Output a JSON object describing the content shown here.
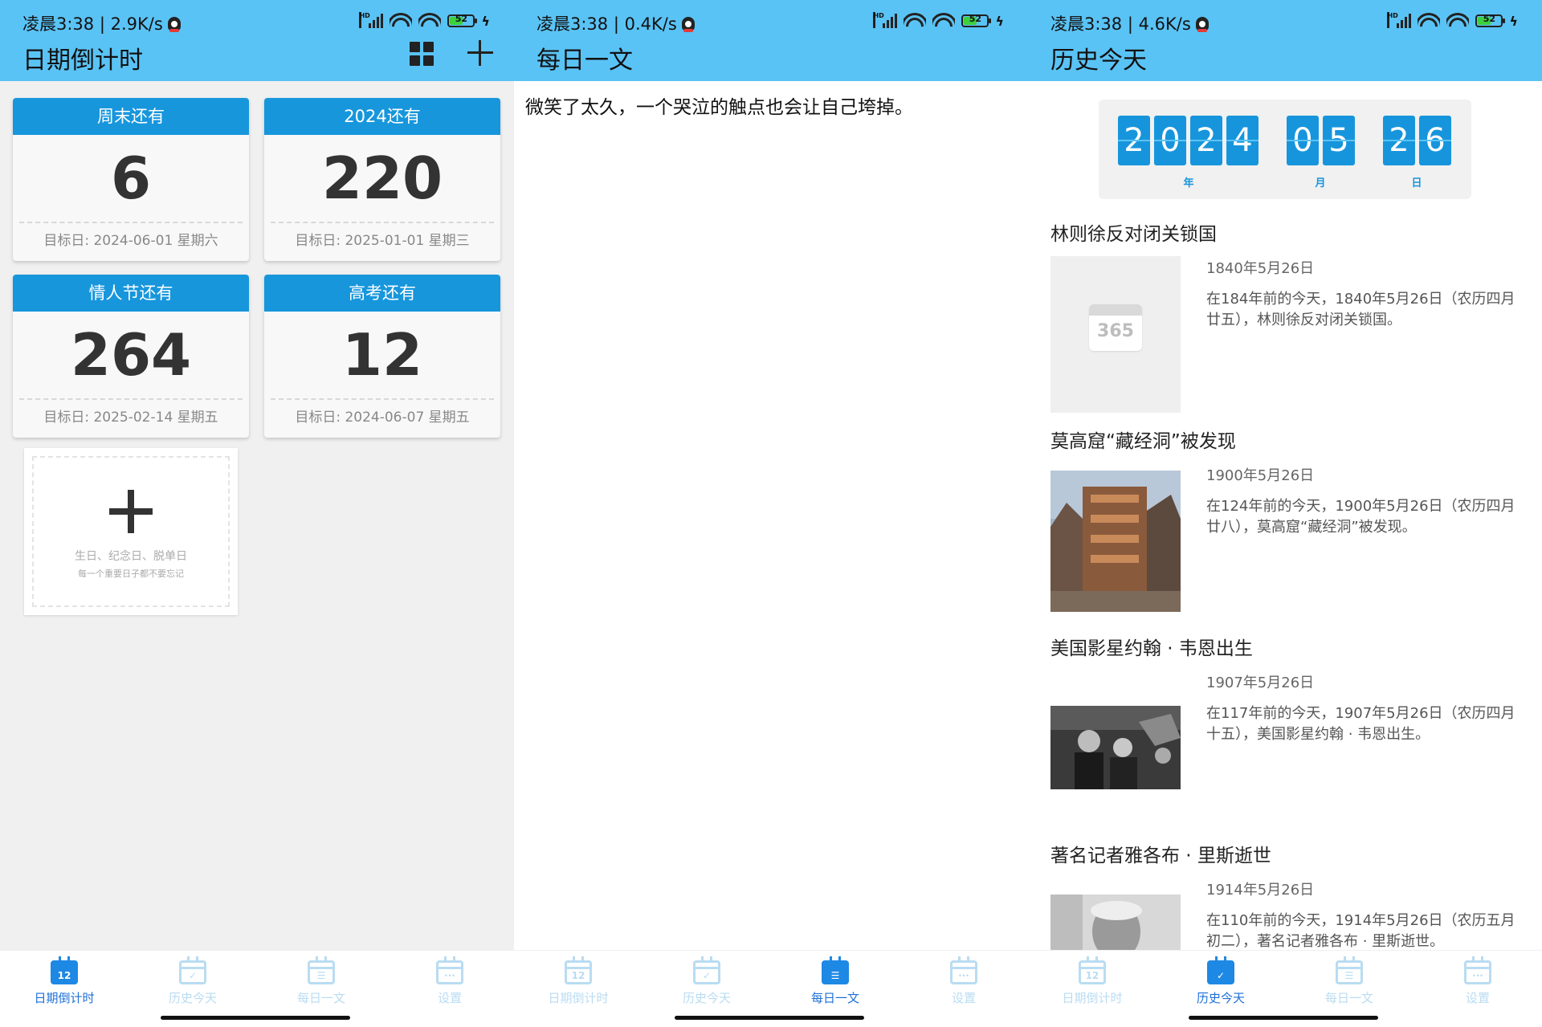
{
  "screens": [
    {
      "status": "凌晨3:38 | 2.9K/s",
      "title": "日期倒计时",
      "cards": [
        {
          "label": "周末还有",
          "days": "6",
          "target": "目标日: 2024-06-01 星期六"
        },
        {
          "label": "2024还有",
          "days": "220",
          "target": "目标日: 2025-01-01 星期三"
        },
        {
          "label": "情人节还有",
          "days": "264",
          "target": "目标日: 2025-02-14 星期五"
        },
        {
          "label": "高考还有",
          "days": "12",
          "target": "目标日: 2024-06-07 星期五"
        }
      ],
      "add_card": {
        "line1": "生日、纪念日、脱单日",
        "line2": "每一个重要日子都不要忘记"
      }
    },
    {
      "status": "凌晨3:38 | 0.4K/s",
      "title": "每日一文",
      "text": "微笑了太久，一个哭泣的触点也会让自己垮掉。"
    },
    {
      "status": "凌晨3:38 | 4.6K/s",
      "title": "历史今天",
      "date_digits": [
        "2",
        "0",
        "2",
        "4",
        "0",
        "5",
        "2",
        "6"
      ],
      "date_labels": {
        "year": "年",
        "month": "月",
        "day": "日"
      },
      "placeholder_text": "365",
      "events": [
        {
          "title": "林则徐反对闭关锁国",
          "date": "1840年5月26日",
          "desc": "在184年前的今天，1840年5月26日（农历四月廿五），林则徐反对闭关锁国。"
        },
        {
          "title": "莫高窟“藏经洞”被发现",
          "date": "1900年5月26日",
          "desc": "在124年前的今天，1900年5月26日（农历四月廿八），莫高窟“藏经洞”被发现。"
        },
        {
          "title": "美国影星约翰 · 韦恩出生",
          "date": "1907年5月26日",
          "desc": "在117年前的今天，1907年5月26日（农历四月十五），美国影星约翰 · 韦恩出生。"
        },
        {
          "title": "著名记者雅各布 · 里斯逝世",
          "date": "1914年5月26日",
          "desc": "在110年前的今天，1914年5月26日（农历五月初二），著名记者雅各布 · 里斯逝世。"
        }
      ]
    }
  ],
  "battery": "52",
  "nav": {
    "countdown": "日期倒计时",
    "history": "历史今天",
    "daily": "每日一文",
    "settings": "设置",
    "cal_num": "12"
  },
  "colors": {
    "appbar": "#5ac3f5",
    "card_header": "#1796dc",
    "accent": "#1e88e5",
    "inactive": "#b9dcf2"
  }
}
